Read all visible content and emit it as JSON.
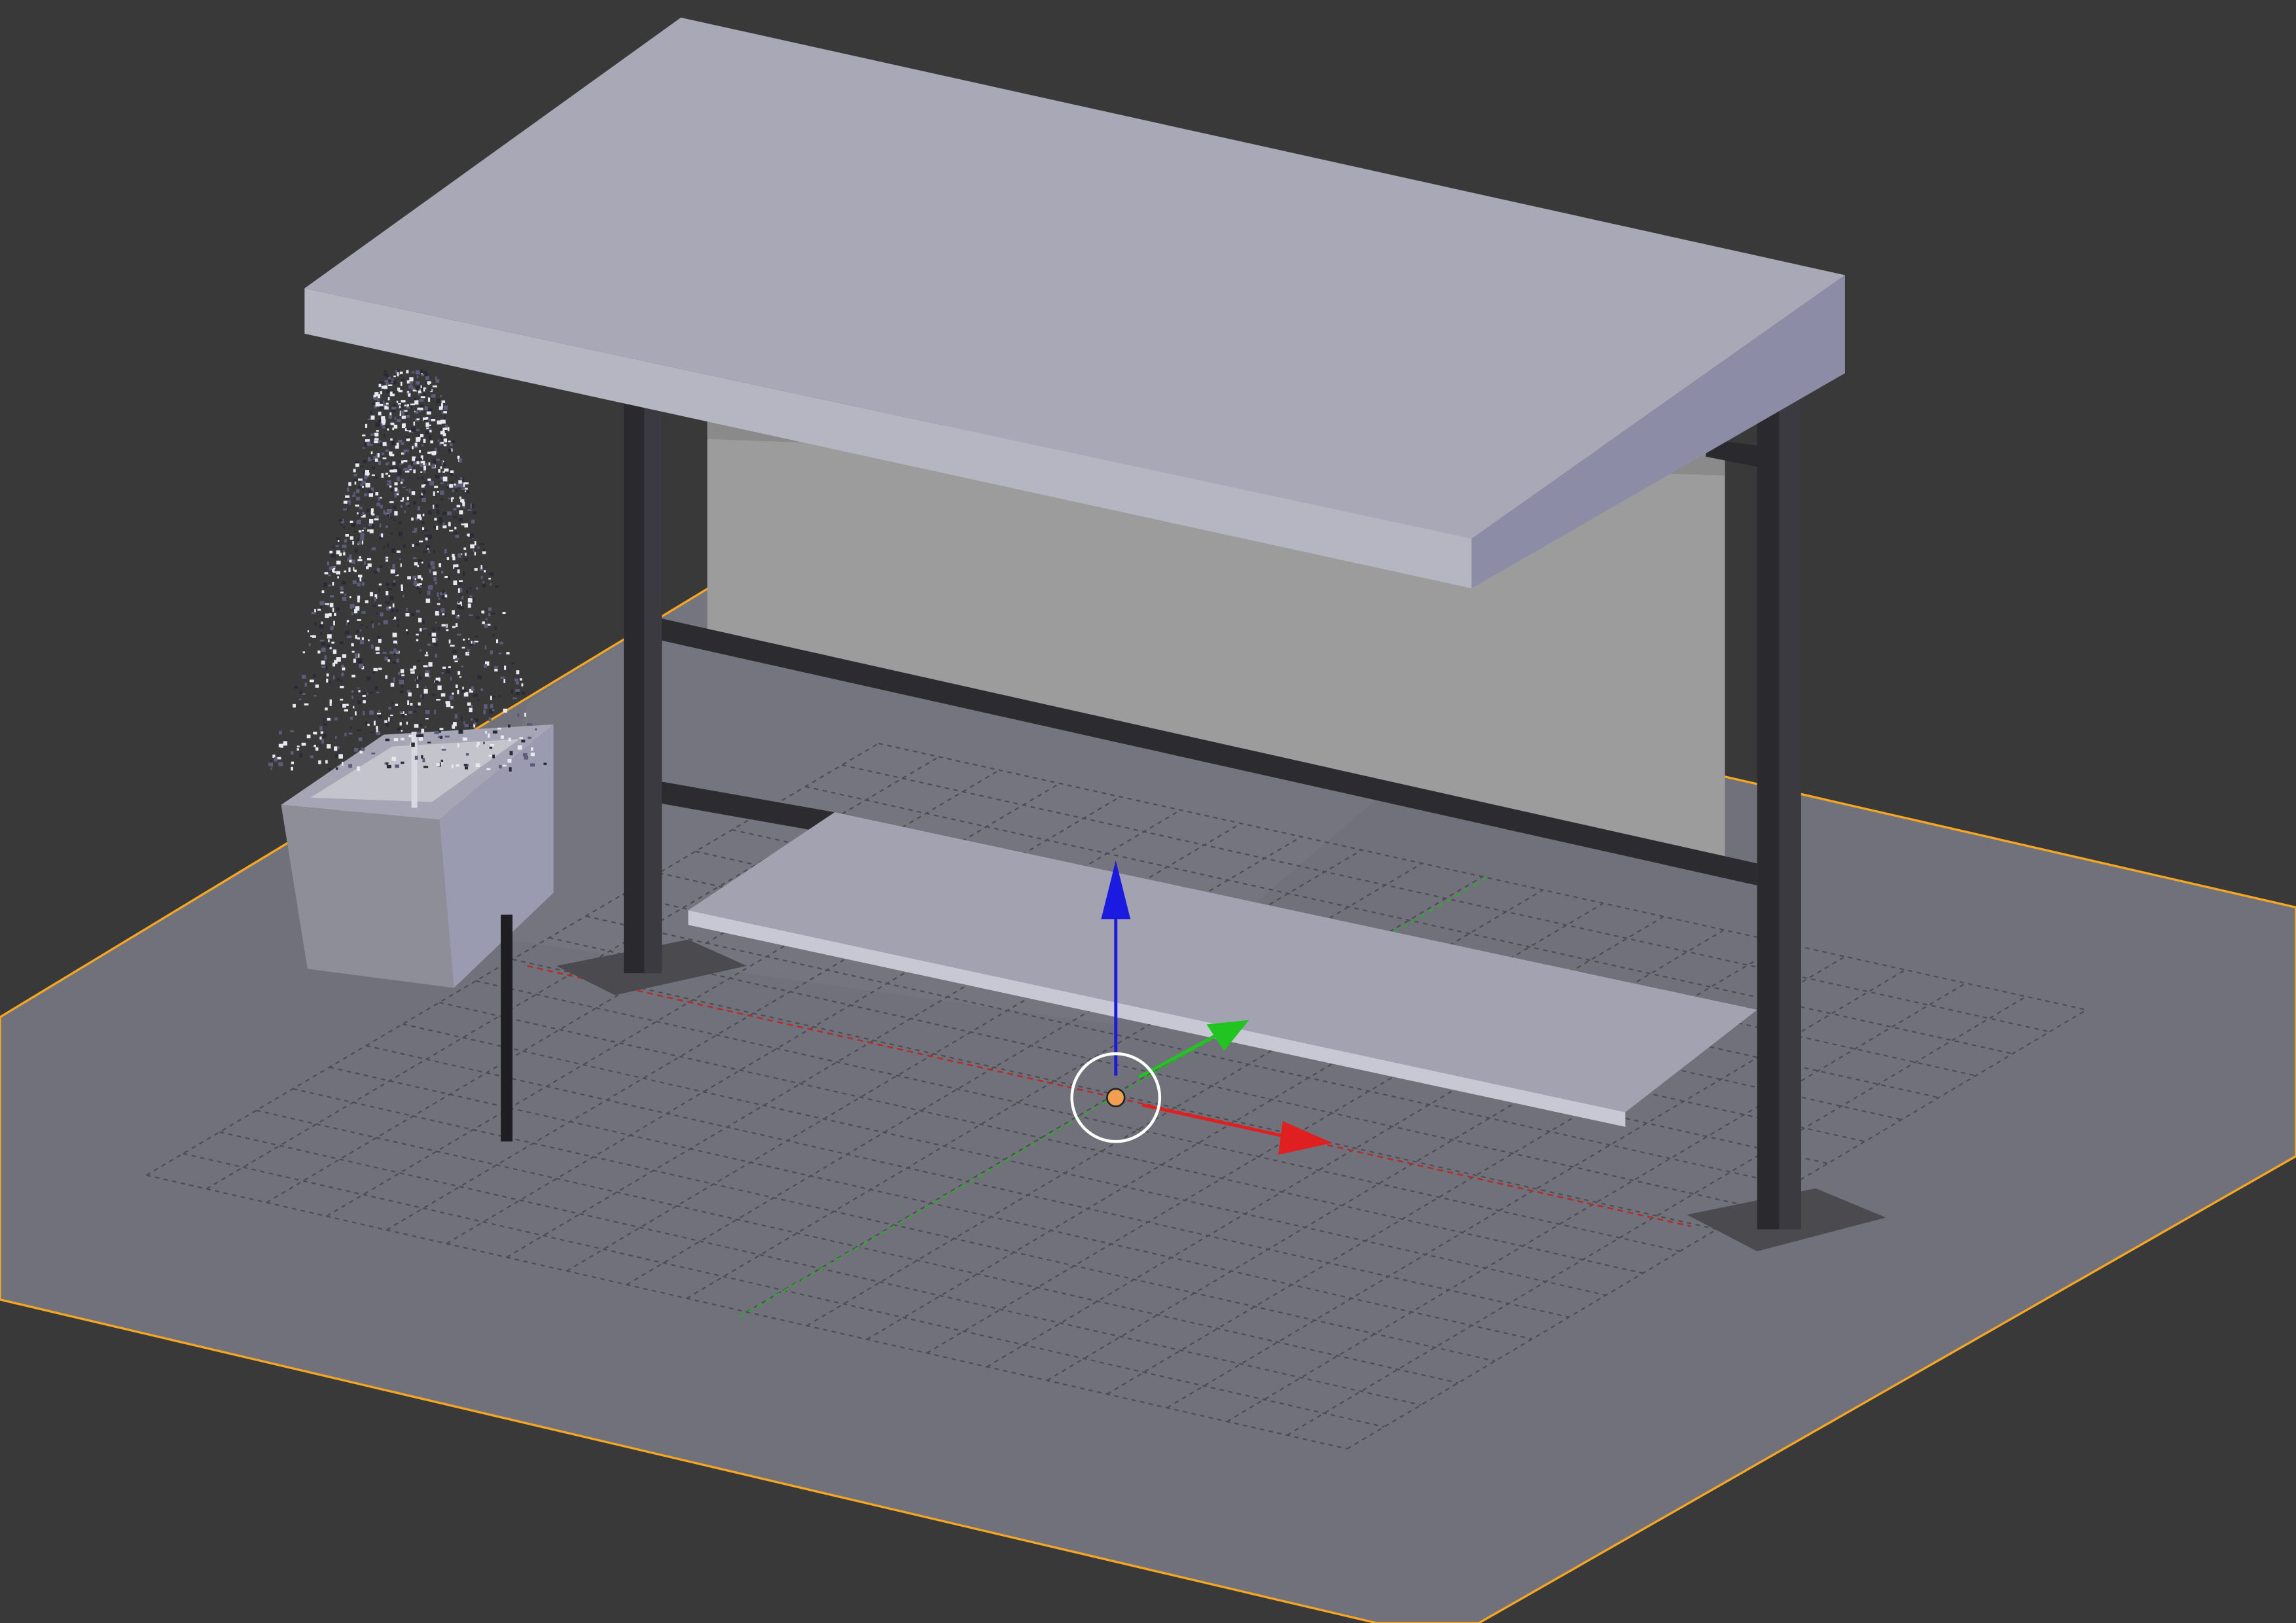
{
  "viewport": {
    "background_color": "#393939",
    "selection_outline_color": "#f5a623",
    "ground_plane_color": "#71717b",
    "grid_color": "#4a4a4a"
  },
  "scene_objects": [
    {
      "name": "ground-plane",
      "selected": true,
      "icon": "plane-mesh-icon"
    },
    {
      "name": "bus-shelter-roof",
      "icon": "cube-mesh-icon"
    },
    {
      "name": "bus-shelter-back-panel",
      "icon": "cube-mesh-icon"
    },
    {
      "name": "bus-shelter-posts",
      "icon": "cube-mesh-icon"
    },
    {
      "name": "bus-shelter-bench",
      "icon": "cube-mesh-icon"
    },
    {
      "name": "planter-box",
      "icon": "cube-mesh-icon"
    },
    {
      "name": "potted-tree",
      "icon": "tree-icon"
    },
    {
      "name": "pole",
      "icon": "cylinder-mesh-icon"
    }
  ],
  "transform_gizmo": {
    "x_axis_color": "#e02020",
    "y_axis_color": "#22c422",
    "z_axis_color": "#1a1ae0",
    "pivot_color": "#f0a050",
    "icon": "move-gizmo-icon"
  }
}
